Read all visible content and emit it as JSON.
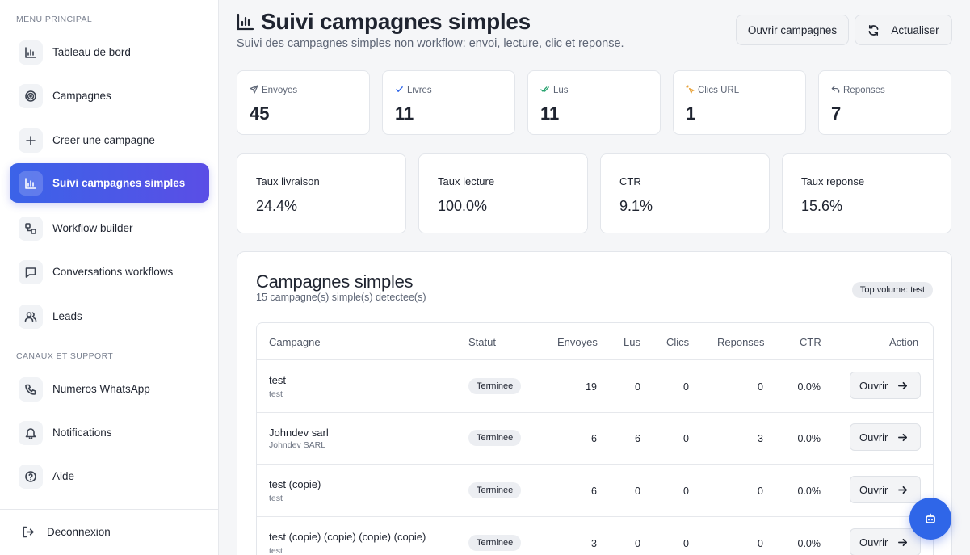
{
  "sidebar": {
    "section_main": "MENU PRINCIPAL",
    "section_support": "CANAUX ET SUPPORT",
    "items": [
      {
        "label": "Tableau de bord",
        "icon": "bar-chart-icon"
      },
      {
        "label": "Campagnes",
        "icon": "target-icon"
      },
      {
        "label": "Creer une campagne",
        "icon": "plus-icon"
      },
      {
        "label": "Suivi campagnes simples",
        "icon": "bar-chart-icon",
        "active": true
      },
      {
        "label": "Workflow builder",
        "icon": "workflow-icon"
      },
      {
        "label": "Conversations workflows",
        "icon": "message-icon"
      },
      {
        "label": "Leads",
        "icon": "users-icon"
      }
    ],
    "support_items": [
      {
        "label": "Numeros WhatsApp",
        "icon": "phone-icon"
      },
      {
        "label": "Notifications",
        "icon": "bell-icon"
      },
      {
        "label": "Aide",
        "icon": "help-icon"
      }
    ],
    "logout_label": "Deconnexion"
  },
  "header": {
    "title": "Suivi campagnes simples",
    "subtitle": "Suivi des campagnes simples non workflow: envoi, lecture, clic et reponse.",
    "open_button": "Ouvrir campagnes",
    "refresh_button": "Actualiser"
  },
  "stats": [
    {
      "label": "Envoyes",
      "value": "45",
      "icon": "send-icon",
      "icon_color": "#5d6575"
    },
    {
      "label": "Livres",
      "value": "11",
      "icon": "check-icon",
      "icon_color": "#2f66e8"
    },
    {
      "label": "Lus",
      "value": "11",
      "icon": "double-check-icon",
      "icon_color": "#22a06b"
    },
    {
      "label": "Clics URL",
      "value": "1",
      "icon": "click-icon",
      "icon_color": "#e8a33b"
    },
    {
      "label": "Reponses",
      "value": "7",
      "icon": "reply-icon",
      "icon_color": "#5d6575"
    }
  ],
  "rates": [
    {
      "label": "Taux livraison",
      "value": "24.4%"
    },
    {
      "label": "Taux lecture",
      "value": "100.0%"
    },
    {
      "label": "CTR",
      "value": "9.1%"
    },
    {
      "label": "Taux reponse",
      "value": "15.6%"
    }
  ],
  "campaigns_panel": {
    "title": "Campagnes simples",
    "subtitle": "15 campagne(s) simple(s) detectee(s)",
    "top_badge": "Top volume: test",
    "columns": [
      "Campagne",
      "Statut",
      "Envoyes",
      "Lus",
      "Clics",
      "Reponses",
      "CTR",
      "Action"
    ],
    "rows": [
      {
        "name": "test",
        "sub": "test",
        "status": "Terminee",
        "envoyes": "19",
        "lus": "0",
        "clics": "0",
        "reponses": "0",
        "ctr": "0.0%",
        "action": "Ouvrir"
      },
      {
        "name": "Johndev sarl",
        "sub": "Johndev SARL",
        "status": "Terminee",
        "envoyes": "6",
        "lus": "6",
        "clics": "0",
        "reponses": "3",
        "ctr": "0.0%",
        "action": "Ouvrir"
      },
      {
        "name": "test (copie)",
        "sub": "test",
        "status": "Terminee",
        "envoyes": "6",
        "lus": "0",
        "clics": "0",
        "reponses": "0",
        "ctr": "0.0%",
        "action": "Ouvrir"
      },
      {
        "name": "test (copie) (copie) (copie) (copie)",
        "sub": "test",
        "status": "Terminee",
        "envoyes": "3",
        "lus": "0",
        "clics": "0",
        "reponses": "0",
        "ctr": "0.0%",
        "action": "Ouvrir"
      }
    ]
  },
  "colors": {
    "accent": "#3b63e8",
    "fab": "#2f66e8"
  }
}
